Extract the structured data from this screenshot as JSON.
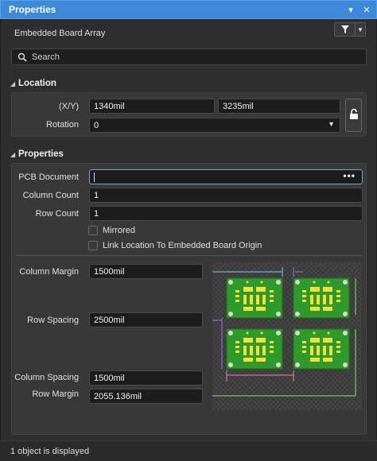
{
  "panel": {
    "title": "Properties",
    "pin_glyph": "▾",
    "close_glyph": "✕"
  },
  "object_type": "Embedded Board Array",
  "search": {
    "placeholder": "Search"
  },
  "location": {
    "header": "Location",
    "xy_label": "(X/Y)",
    "x_value": "1340mil",
    "y_value": "3235mil",
    "rotation_label": "Rotation",
    "rotation_value": "0"
  },
  "properties": {
    "header": "Properties",
    "pcb_document_label": "PCB Document",
    "pcb_document_value": "",
    "browse_glyph": "•••",
    "column_count_label": "Column Count",
    "column_count_value": "1",
    "row_count_label": "Row Count",
    "row_count_value": "1",
    "mirrored_label": "Mirrored",
    "link_location_label": "Link Location To Embedded Board Origin",
    "column_margin_label": "Column Margin",
    "column_margin_value": "1500mil",
    "row_spacing_label": "Row Spacing",
    "row_spacing_value": "2500mil",
    "column_spacing_label": "Column Spacing",
    "column_spacing_value": "1500mil",
    "row_margin_label": "Row Margin",
    "row_margin_value": "2055.136mil"
  },
  "status": {
    "text": "1 object is displayed"
  },
  "colors": {
    "accent": "#3c8ad8",
    "board_green": "#2f9a2c",
    "pad_yellow": "#f3e03a",
    "arrow_cyan": "#7ec8e8",
    "arrow_pink": "#e08ab8",
    "arrow_purple": "#a070e0",
    "arrow_green": "#8ae070",
    "arrow_yellow": "#e8e060"
  },
  "icons": {
    "filter": "funnel-icon",
    "search": "magnifier-icon",
    "lock": "padlock-icon"
  }
}
